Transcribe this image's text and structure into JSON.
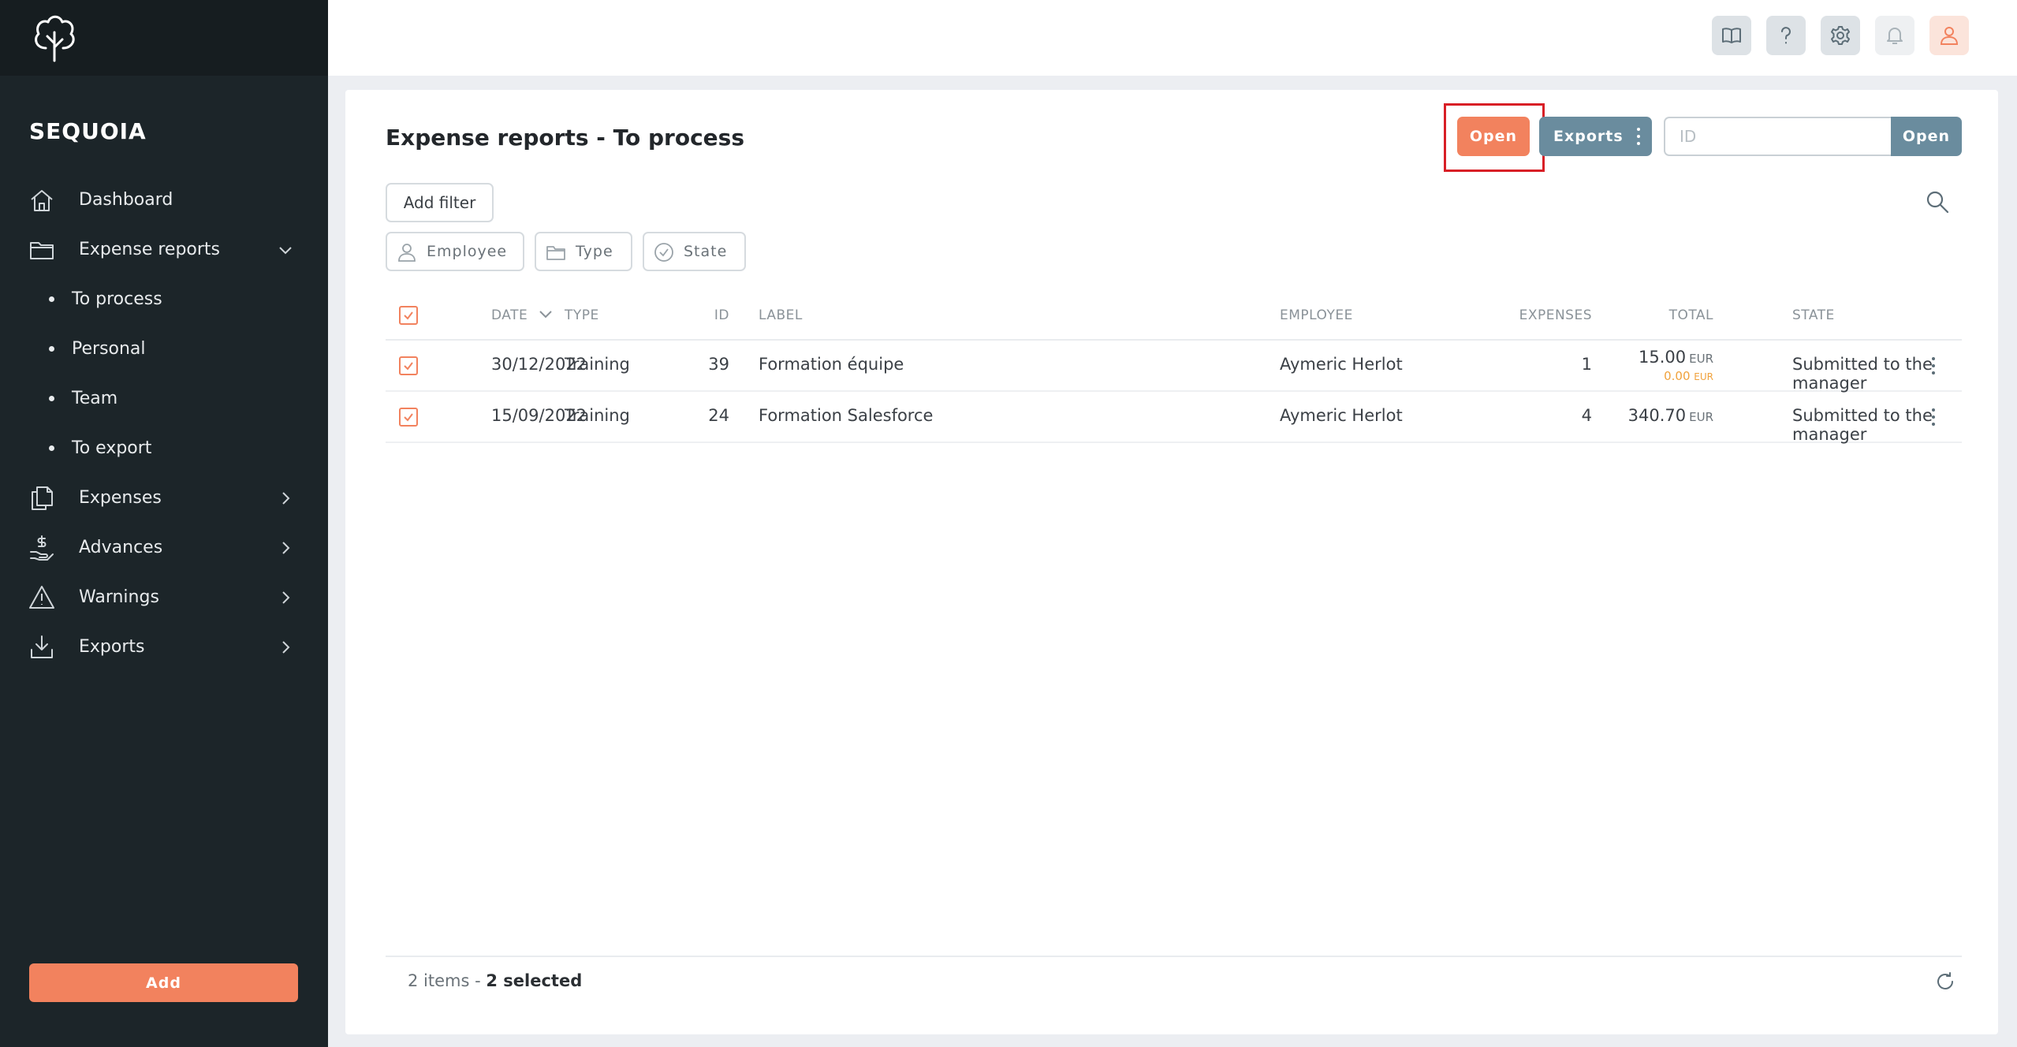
{
  "sidebar": {
    "brand": "SEQUOIA",
    "nav": [
      {
        "label": "Dashboard",
        "icon": "home-icon"
      },
      {
        "label": "Expense reports",
        "icon": "folder-icon",
        "expanded": true,
        "children": [
          {
            "label": "To process"
          },
          {
            "label": "Personal"
          },
          {
            "label": "Team"
          },
          {
            "label": "To export"
          }
        ]
      },
      {
        "label": "Expenses",
        "icon": "documents-icon"
      },
      {
        "label": "Advances",
        "icon": "hand-coin-icon"
      },
      {
        "label": "Warnings",
        "icon": "warning-icon"
      },
      {
        "label": "Exports",
        "icon": "download-icon"
      }
    ],
    "add_label": "Add"
  },
  "topbar": {
    "icons": [
      "book-icon",
      "help-icon",
      "gear-icon",
      "bell-icon",
      "user-icon"
    ]
  },
  "main": {
    "title": "Expense reports - To process",
    "open_label": "Open",
    "exports_label": "Exports",
    "id_placeholder": "ID",
    "id_open_label": "Open",
    "add_filter_label": "Add filter",
    "chips": [
      {
        "label": "Employee",
        "icon": "user-icon"
      },
      {
        "label": "Type",
        "icon": "folder-icon"
      },
      {
        "label": "State",
        "icon": "check-circle-icon"
      }
    ]
  },
  "table": {
    "columns": [
      "DATE",
      "TYPE",
      "ID",
      "LABEL",
      "EXPENSES",
      "TOTAL",
      "STATE",
      "EMPLOYEE"
    ],
    "rows": [
      {
        "date": "30/12/2022",
        "type": "Training",
        "id": "39",
        "label": "Formation équipe",
        "expenses": "1",
        "total": "15.00",
        "currency": "EUR",
        "sub_total": "0.00",
        "sub_currency": "EUR",
        "state": "Submitted to the manager",
        "employee": "Aymeric Herlot"
      },
      {
        "date": "15/09/2022",
        "type": "Training",
        "id": "24",
        "label": "Formation Salesforce",
        "expenses": "4",
        "total": "340.70",
        "currency": "EUR",
        "state": "Submitted to the manager",
        "employee": "Aymeric Herlot"
      }
    ]
  },
  "footer": {
    "items_text": "2 items - ",
    "selected_text": "2 selected"
  },
  "colors": {
    "accent": "#f2825e",
    "secondary": "#6a8c9e",
    "sidebar_bg": "#1c2529",
    "highlight_border": "#d81f26"
  }
}
